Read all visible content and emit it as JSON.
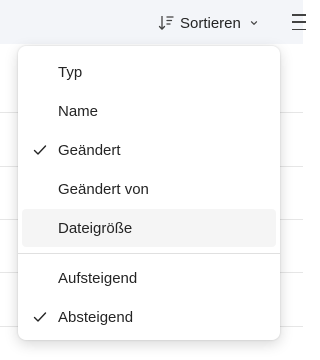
{
  "toolbar": {
    "sort_label": "Sortieren",
    "sort_icon": "sort-descending-icon",
    "chevron_icon": "chevron-down-icon",
    "more_icon": "view-options-icon"
  },
  "menu": {
    "sort_fields": [
      {
        "label": "Typ",
        "checked": false
      },
      {
        "label": "Name",
        "checked": false
      },
      {
        "label": "Geändert",
        "checked": true
      },
      {
        "label": "Geändert von",
        "checked": false
      },
      {
        "label": "Dateigröße",
        "checked": false,
        "hovered": true
      }
    ],
    "sort_orders": [
      {
        "label": "Aufsteigend",
        "checked": false
      },
      {
        "label": "Absteigend",
        "checked": true
      }
    ],
    "check_icon": "checkmark-icon"
  },
  "colors": {
    "toolbar_bg": "#f3f5f9",
    "menu_bg": "#ffffff",
    "hover_bg": "#f5f5f5",
    "text": "#242424"
  }
}
